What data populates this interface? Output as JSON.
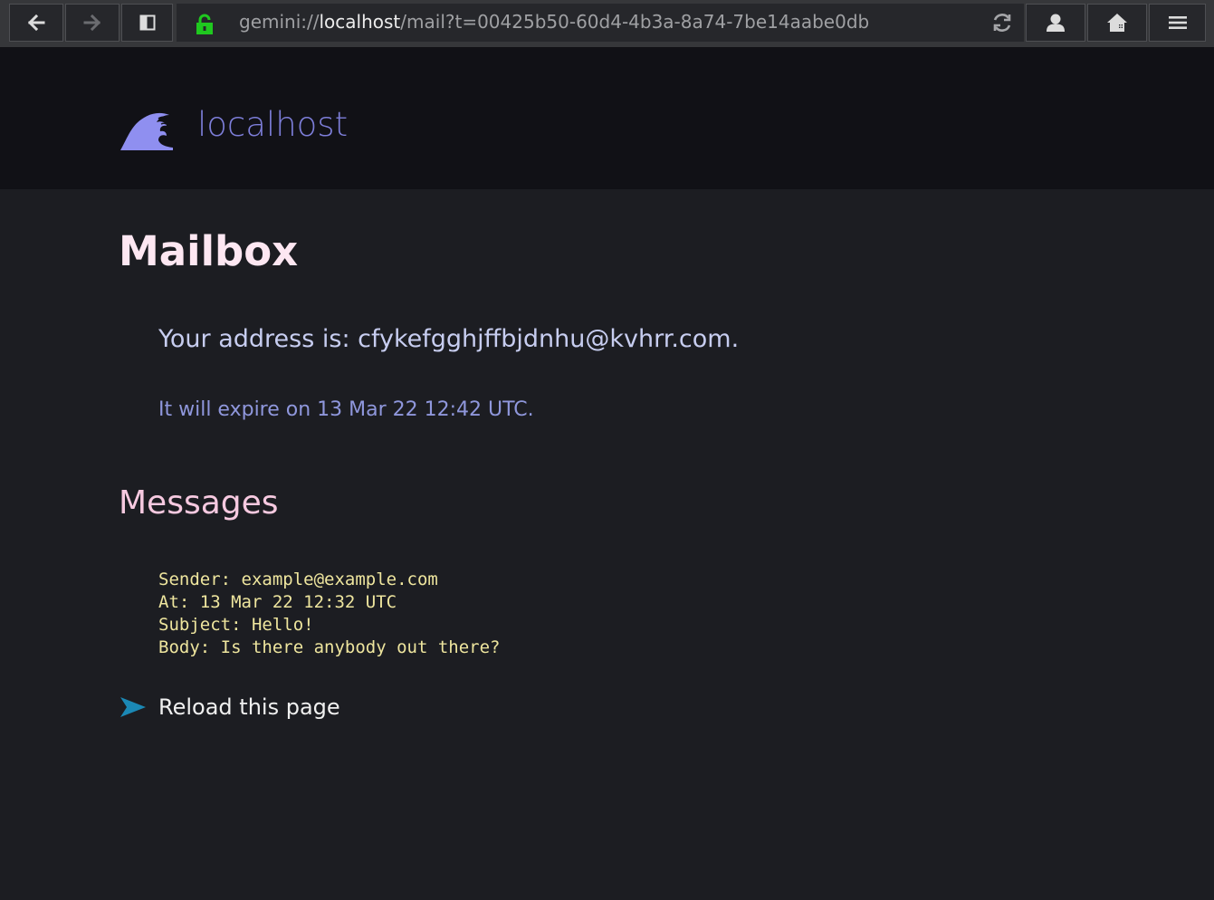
{
  "toolbar": {
    "url_scheme": "gemini://",
    "url_host": "localhost",
    "url_path": "/mail?t=00425b50-60d4-4b3a-8a74-7be14aabe0db",
    "icons": {
      "back": "arrow-left-icon",
      "forward": "arrow-right-icon",
      "sidebar": "sidebar-toggle-icon",
      "lock": "lock-icon",
      "reload": "reload-icon",
      "identity": "person-icon",
      "home": "home-icon",
      "menu": "hamburger-menu-icon"
    },
    "lock_color": "#1fc81f"
  },
  "banner": {
    "site_name": "localhost",
    "icon": "wave-icon",
    "accent_color": "#7d7ed9"
  },
  "page": {
    "heading": "Mailbox",
    "address_line": "Your address is: cfykefgghjffbjdnhu@kvhrr.com.",
    "expire_line": "It will expire on 13 Mar 22 12:42 UTC.",
    "messages_heading": "Messages",
    "message_lines": [
      "Sender: example@example.com",
      "At: 13 Mar 22 12:32 UTC",
      "Subject: Hello!",
      "Body: Is there anybody out there?"
    ],
    "reload_link": "Reload this page",
    "link_icon": "arrow-link-icon"
  }
}
